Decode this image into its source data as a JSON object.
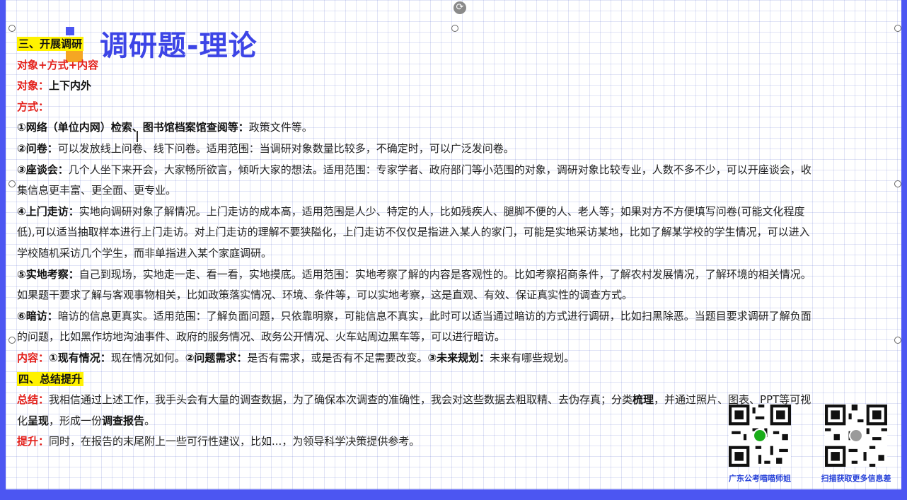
{
  "title": "调研题-理论",
  "section3": {
    "heading": "三、开展调研"
  },
  "formula": "对象+方式+内容",
  "object": {
    "label": "对象：",
    "text": "上下内外"
  },
  "method": {
    "label": "方式："
  },
  "item1": {
    "label": "①网络（单位内网）检索、图书馆档案馆查阅等：",
    "text": "政策文件等。"
  },
  "item2": {
    "label": "②问卷：",
    "text": "可以发放线上问卷、线下问卷。适用范围：当调研对象数量比较多，不确定时，可以广泛发问卷。"
  },
  "item3": {
    "label": "③座谈会：",
    "text1": "几个人坐下来开会，大家畅所欲言，倾听大家的想法。适用范围：专家学者、政府部门等小范围的对象，调研对象比较专业，人数不多不少，可以开座谈会，收",
    "text2": "集信息更丰富、更全面、更专业。"
  },
  "item4": {
    "label": "④上门走访：",
    "text1": "实地向调研对象了解情况。上门走访的成本高，适用范围是人少、特定的人，比如残疾人、腿脚不便的人、老人等；如果对方不方便填写问卷(可能文化程度",
    "text2": "低),可以适当抽取样本进行上门走访。对上门走访的理解不要狭隘化，上门走访不仅仅是指进入某人的家门，可能是实地采访某地，比如了解某学校的学生情况，可以进入",
    "text3": "学校随机采访几个学生，而非单指进入某个家庭调研。"
  },
  "item5": {
    "label": "⑤实地考察：",
    "text1": "自己到现场，实地走一走、看一看，实地摸底。适用范围：实地考察了解的内容是客观性的。比如考察招商条件，了解农村发展情况，了解环境的相关情况。",
    "text2": "如果题干要求了解与客观事物相关，比如政策落实情况、环境、条件等，可以实地考察，这是直观、有效、保证真实性的调查方式。"
  },
  "item6": {
    "label": "⑥暗访：",
    "text1": "暗访的信息更真实。适用范围：了解负面问题，只依靠明察，可能信息不真实，此时可以适当通过暗访的方式进行调研，比如扫黑除恶。当题目要求调研了解负面",
    "text2": "的问题，比如黑作坊地沟油事件、政府的服务情况、政务公开情况、火车站周边黑车等，可以进行暗访。"
  },
  "content": {
    "label": "内容：",
    "p1_label": "①现有情况：",
    "p1_text": "现在情况如何。",
    "p2_label": "②问题需求：",
    "p2_text": "是否有需求，或是否有不足需要改变。",
    "p3_label": "③未来规划：",
    "p3_text": "未来有哪些规划。"
  },
  "section4": {
    "heading": "四、总结提升"
  },
  "summary": {
    "label": "总结：",
    "text1": "我相信通过上述工作，我手头会有大量的调查数据，为了确保本次调查的准确性，我会对这些数据去粗取精、去伪存真；分类",
    "bold1": "梳理",
    "text2": "，并通过照片、图表、PPT等可视",
    "text3": "化",
    "bold2": "呈现",
    "text4": "，形成一份",
    "bold3": "调查报告",
    "text5": "。"
  },
  "improve": {
    "label": "提升：",
    "text": "同时，在报告的末尾附上一些可行性建议，比如...，为领导科学决策提供参考。"
  },
  "qr1": {
    "label": "广东公考喵喵师姐",
    "icon": "wechat-icon"
  },
  "qr2": {
    "label": "扫描获取更多信息差",
    "icon": "avatar-icon"
  },
  "colors": {
    "accent": "#4c56f2",
    "title": "#3d45e6",
    "red": "#e3201b",
    "highlight": "#fff200"
  }
}
